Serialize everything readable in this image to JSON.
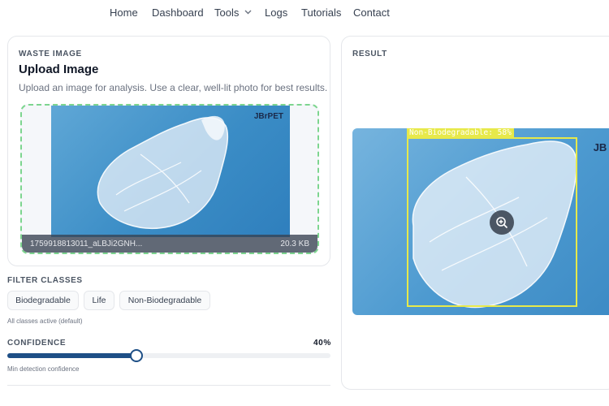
{
  "nav": {
    "items": [
      {
        "label": "Home"
      },
      {
        "label": "Dashboard"
      },
      {
        "label": "Tools"
      },
      {
        "label": "Logs"
      },
      {
        "label": "Tutorials"
      },
      {
        "label": "Contact"
      }
    ]
  },
  "upload": {
    "section_label": "WASTE IMAGE",
    "title": "Upload Image",
    "description": "Upload an image for analysis. Use a clear, well-lit photo for best results.",
    "file_name": "1759918813011_aLBJi2GNH...",
    "file_size": "20.3 KB",
    "logo_text": "JBrPET"
  },
  "filter": {
    "section_label": "FILTER CLASSES",
    "chips": [
      "Biodegradable",
      "Life",
      "Non-Biodegradable"
    ],
    "note": "All classes active (default)"
  },
  "confidence": {
    "section_label": "CONFIDENCE",
    "value_label": "40%",
    "value": 0.4,
    "note": "Min detection confidence"
  },
  "result": {
    "section_label": "RESULT",
    "detection_label": "Non-Biodegradable: 58%",
    "logo_text": "JB r"
  },
  "colors": {
    "accent": "#1e4f86",
    "dropzone_border": "#7dd58f",
    "bbox": "#e7e94a"
  },
  "icons": {
    "tools_dropdown": "chevron-down-icon",
    "zoom": "zoom-in-icon"
  }
}
